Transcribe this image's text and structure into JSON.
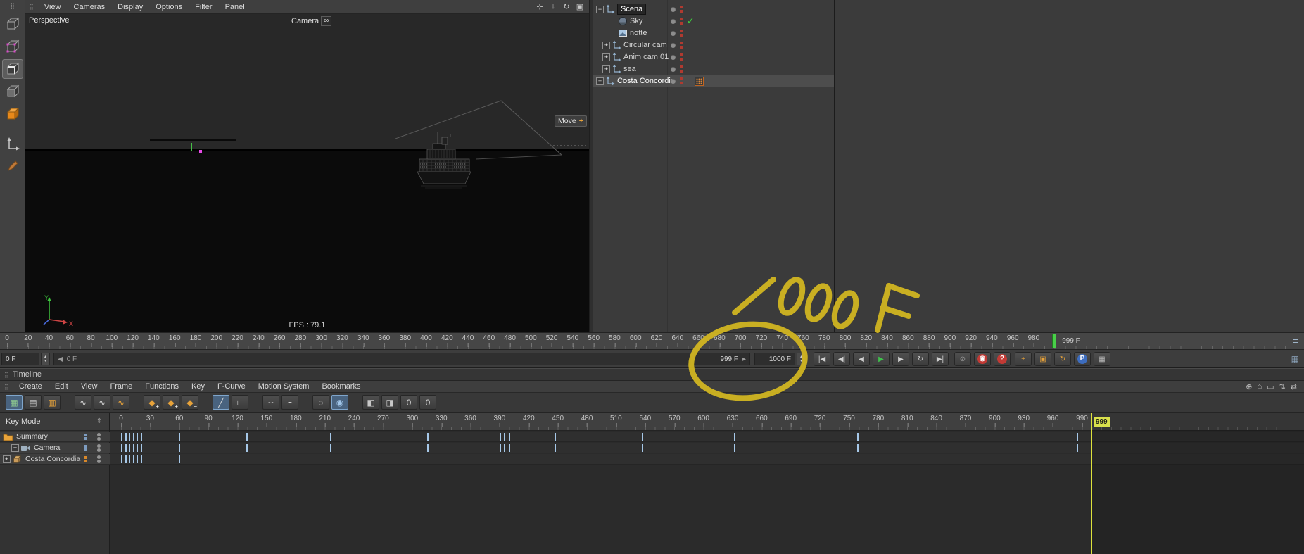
{
  "app": {
    "grip_icon": "⣿"
  },
  "left_toolbar": {
    "tools": [
      {
        "name": "nav-cube-tool",
        "type": "cube-plain"
      },
      {
        "name": "points-mode-tool",
        "type": "cube-points"
      },
      {
        "name": "edges-mode-tool",
        "type": "cube-edges",
        "selected": true
      },
      {
        "name": "polygons-mode-tool",
        "type": "cube-polys"
      },
      {
        "name": "model-mode-tool",
        "type": "cube-model"
      },
      {
        "name": "axis-mode-tool",
        "type": "axis",
        "gap": true
      },
      {
        "name": "texture-tool",
        "type": "pen"
      }
    ]
  },
  "viewport_menu": {
    "items": [
      "View",
      "Cameras",
      "Display",
      "Options",
      "Filter",
      "Panel"
    ],
    "nav_icons": [
      {
        "name": "pan-view-icon",
        "glyph": "⊹"
      },
      {
        "name": "zoom-view-icon",
        "glyph": "↓"
      },
      {
        "name": "rotate-view-icon",
        "glyph": "↻"
      },
      {
        "name": "toggle-view-icon",
        "glyph": "▣"
      }
    ]
  },
  "viewport": {
    "view_label": "Perspective",
    "camera_label": "Camera",
    "camera_badge": "∞",
    "move_badge": {
      "label": "Move",
      "plus": "+"
    },
    "fps_label": "FPS : 79.1",
    "axis_labels": {
      "x": "X",
      "y": "Y"
    }
  },
  "object_manager": {
    "rows": [
      {
        "label": "Scena",
        "depth": 0,
        "expand": "−",
        "icon": "null",
        "label_selected": true
      },
      {
        "label": "Sky",
        "depth": 2,
        "expand": "",
        "icon": "sky",
        "check": "✓"
      },
      {
        "label": "notte",
        "depth": 2,
        "expand": "",
        "icon": "material"
      },
      {
        "label": "Circular cam",
        "depth": 1,
        "expand": "+",
        "icon": "null"
      },
      {
        "label": "Anim cam 01",
        "depth": 1,
        "expand": "+",
        "icon": "null"
      },
      {
        "label": "sea",
        "depth": 1,
        "expand": "+",
        "icon": "null"
      },
      {
        "label": "Costa Concordia",
        "depth": 0,
        "expand": "+",
        "icon": "null",
        "row_selected": true,
        "tag": true
      }
    ]
  },
  "main_ruler": {
    "start": 0,
    "end": 980,
    "step": 20,
    "current_frame": 999,
    "current_label": "999 F",
    "panel_icon": "≣"
  },
  "transport": {
    "frame_field": "0 F",
    "slider_prefix": "◀",
    "slider_value": "0 F",
    "end_field": "999 F",
    "end_field_arrow": "▸",
    "max_field": "1000 F",
    "stepper_up": "▴",
    "stepper_down": "▾",
    "buttons": [
      {
        "name": "goto-start-button",
        "glyph": "|◀"
      },
      {
        "name": "prev-key-button",
        "glyph": "◀|"
      },
      {
        "name": "prev-frame-button",
        "glyph": "◀"
      },
      {
        "name": "play-button",
        "glyph": "▶",
        "color": "#3fc14c"
      },
      {
        "name": "next-frame-button",
        "glyph": "▶"
      },
      {
        "name": "play-mode-button",
        "glyph": "↻"
      },
      {
        "name": "goto-end-button",
        "glyph": "▶|"
      }
    ],
    "record_buttons": [
      {
        "name": "keyframe-selection-button",
        "glyph": "⊘",
        "color": "#9a9a9a"
      },
      {
        "name": "record-button",
        "glyph": "◉",
        "circle": true
      },
      {
        "name": "autokey-button",
        "glyph": "?",
        "circle": true
      }
    ],
    "keying_buttons": [
      {
        "name": "key-position-button",
        "glyph": "+",
        "color": "#e8a33a"
      },
      {
        "name": "key-scale-button",
        "glyph": "▣",
        "color": "#e8a33a"
      },
      {
        "name": "key-rotation-button",
        "glyph": "↻",
        "color": "#e8a33a"
      },
      {
        "name": "key-parameter-button",
        "glyph": "P",
        "pcircle": true
      },
      {
        "name": "key-pla-button",
        "glyph": "▦",
        "color": "#b8b8b8"
      }
    ],
    "panel_icon": "▦"
  },
  "timeline": {
    "title": "Timeline",
    "menu_items": [
      "Create",
      "Edit",
      "View",
      "Frame",
      "Functions",
      "Key",
      "F-Curve",
      "Motion System",
      "Bookmarks"
    ],
    "right_icons": [
      {
        "name": "zoom-icon",
        "glyph": "⊕"
      },
      {
        "name": "home-icon",
        "glyph": "⌂"
      },
      {
        "name": "frame-all-icon",
        "glyph": "▭"
      },
      {
        "name": "v-scroll-icon",
        "glyph": "⇅"
      },
      {
        "name": "h-scroll-icon",
        "glyph": "⇄"
      }
    ],
    "toolbar_groups": [
      {
        "items": [
          {
            "name": "dopesheet-mode-button",
            "glyph": "▦",
            "color": "#8fc98f",
            "selected": true
          },
          {
            "name": "fcurve-mode-button",
            "glyph": "▤",
            "color": "#c0c0c0"
          },
          {
            "name": "motion-mode-button",
            "glyph": "▥",
            "color": "#e8a33a"
          }
        ]
      },
      {
        "items": [
          {
            "name": "wave-linear-button",
            "glyph": "∿",
            "color": "#d0d0d0"
          },
          {
            "name": "wave-smooth-button",
            "glyph": "∿",
            "color": "#d0d0d0"
          },
          {
            "name": "wave-step-button",
            "glyph": "∿",
            "color": "#e8a33a"
          }
        ]
      },
      {
        "items": [
          {
            "name": "add-key-button",
            "glyph": "◆",
            "plus": "+",
            "color": "#e8a33a"
          },
          {
            "name": "add-key-track-button",
            "glyph": "◆",
            "plus": "+",
            "color": "#e8a33a"
          },
          {
            "name": "delete-key-button",
            "glyph": "◆",
            "plus": "−",
            "color": "#e8a33a"
          }
        ]
      },
      {
        "items": [
          {
            "name": "linear-interp-button",
            "glyph": "╱",
            "color": "#d8d8d8",
            "selected": true
          },
          {
            "name": "step-interp-button",
            "glyph": "∟",
            "color": "#d8d8d8"
          }
        ]
      },
      {
        "items": [
          {
            "name": "ease-in-button",
            "glyph": "⌣",
            "color": "#d8d8d8"
          },
          {
            "name": "ease-out-button",
            "glyph": "⌢",
            "color": "#d8d8d8"
          }
        ]
      },
      {
        "items": [
          {
            "name": "clamp-button",
            "glyph": "◌",
            "color": "#d8d8d8"
          },
          {
            "name": "auto-tangent-button",
            "glyph": "◉",
            "color": "#9fc4e7",
            "selected": true
          }
        ]
      },
      {
        "items": [
          {
            "name": "marker-left-button",
            "glyph": "◧",
            "color": "#c8c8c8"
          },
          {
            "name": "marker-right-button",
            "glyph": "◨",
            "color": "#c8c8c8"
          },
          {
            "name": "zero-length-key-button",
            "glyph": "0",
            "color": "#d8d8d8"
          },
          {
            "name": "zero-value-key-button",
            "glyph": "0",
            "color": "#d8d8d8"
          }
        ]
      }
    ],
    "mode_label": "Key Mode",
    "mode_spinner": "⇕",
    "ruler": {
      "start": 0,
      "end": 990,
      "step": 30
    },
    "current_frame": "999",
    "tracks": [
      {
        "label": "Summary",
        "icon": "folder",
        "depth": 0,
        "expand": "",
        "keys": [
          1,
          5,
          9,
          13,
          17,
          21,
          60,
          130,
          216,
          316,
          391,
          395,
          400,
          447,
          537,
          632,
          759,
          985
        ]
      },
      {
        "label": "Camera",
        "icon": "camera",
        "depth": 1,
        "expand": "+",
        "keys": [
          1,
          5,
          9,
          13,
          17,
          21,
          60,
          130,
          216,
          316,
          391,
          395,
          400,
          447,
          537,
          632,
          759,
          985
        ]
      },
      {
        "label": "Costa Concordia",
        "icon": "cube",
        "depth": 0,
        "expand": "+",
        "sq_color": "#d8882a",
        "keys": [
          1,
          5,
          9,
          13,
          17,
          21,
          60
        ]
      }
    ]
  },
  "annotation": {
    "text": "1000F",
    "color": "#d4b821"
  }
}
